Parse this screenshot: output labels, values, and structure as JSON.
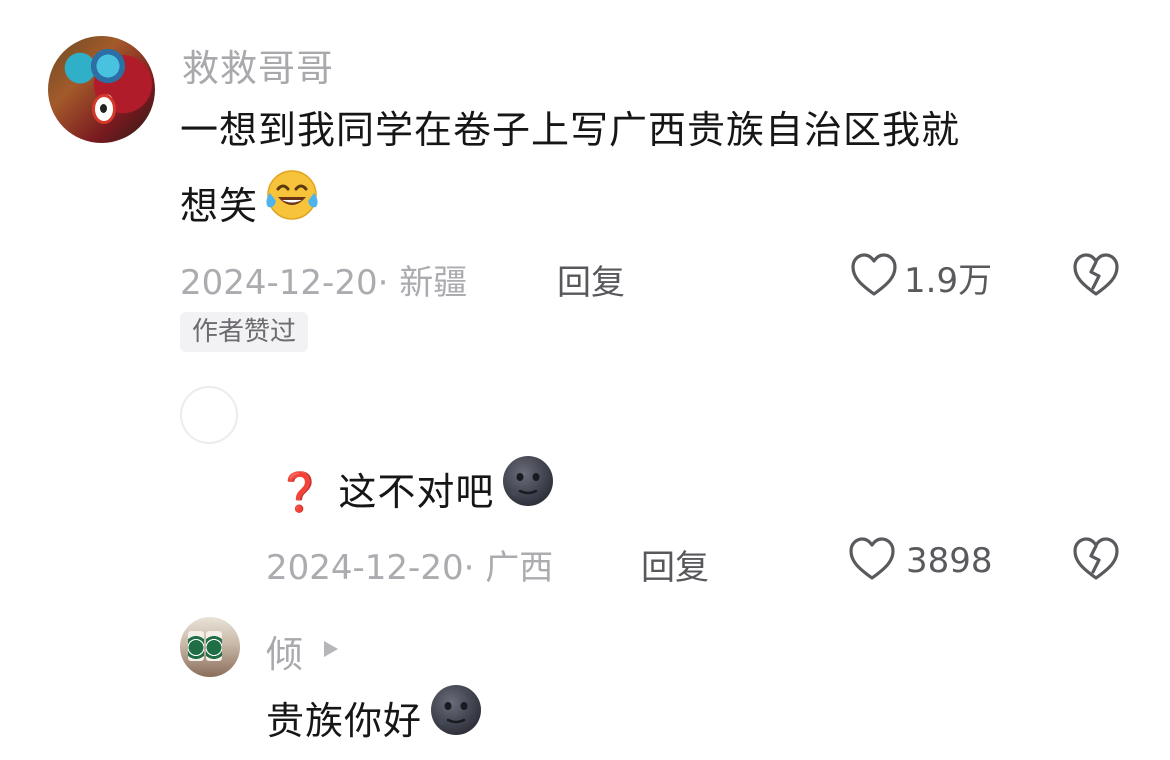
{
  "comment": {
    "username": "救救哥哥",
    "text_line1": "一想到我同学在卷子上写广西贵族自治区我就",
    "text_line2": "想笑",
    "emoji": "tears-of-joy",
    "date": "2024-12-20",
    "location": "· 新疆",
    "reply_label": "回复",
    "like_count": "1.9万",
    "author_badge": "作者赞过"
  },
  "reply1": {
    "prefix_emoji": "❓",
    "text": "这不对吧",
    "emoji": "new-moon-face",
    "date": "2024-12-20",
    "location": "· 广西",
    "reply_label": "回复",
    "like_count": "3898"
  },
  "reply2": {
    "username": "倾",
    "text": "贵族你好",
    "emoji": "new-moon-face"
  },
  "colors": {
    "meta_gray": "#ababb0",
    "text": "#161616",
    "badge_bg": "#f2f2f4"
  }
}
